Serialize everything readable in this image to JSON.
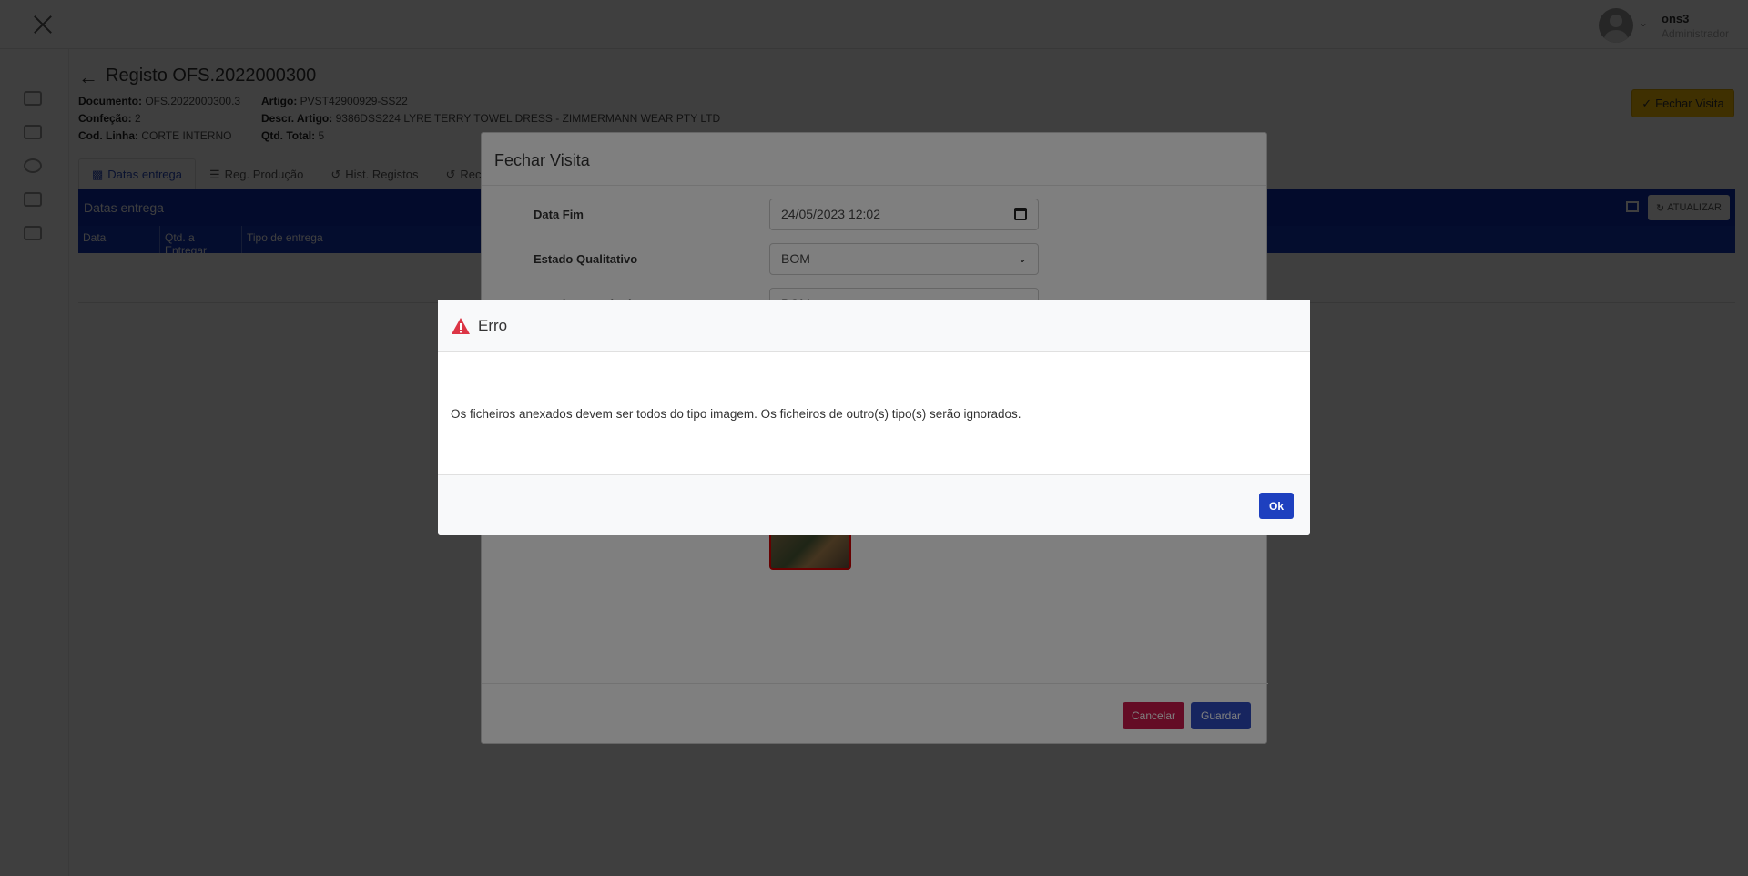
{
  "header": {
    "user_name": "ons3",
    "user_role": "Administrador"
  },
  "page": {
    "title": "Registo OFS.2022000300",
    "fechar_visita_label": "Fechar Visita",
    "info": {
      "documento_label": "Documento:",
      "documento": "OFS.2022000300.3",
      "confecao_label": "Confeção:",
      "confecao": "2",
      "cod_linha_label": "Cod. Linha:",
      "cod_linha": "CORTE INTERNO",
      "artigo_label": "Artigo:",
      "artigo": "PVST42900929-SS22",
      "descr_artigo_label": "Descr. Artigo:",
      "descr_artigo": "9386DSS224 LYRE TERRY TOWEL DRESS - ZIMMERMANN WEAR PTY LTD",
      "qtd_total_label": "Qtd. Total:",
      "qtd_total": "5"
    },
    "tabs": [
      "Datas entrega",
      "Reg. Produção",
      "Hist. Registos",
      "Rec. M"
    ],
    "panel_title": "Datas entrega",
    "atualizar_label": "ATUALIZAR",
    "grid_columns": [
      "Data",
      "Qtd. a Entregar",
      "Tipo de entrega"
    ]
  },
  "modal_fechar": {
    "title": "Fechar Visita",
    "data_fim_label": "Data Fim",
    "data_fim_value": "24/05/2023 12:02",
    "estado_qualitativo_label": "Estado Qualitativo",
    "estado_qualitativo_value": "BOM",
    "estado_quantitativo_label": "Estado Quantitativo",
    "estado_quantitativo_value": "BOM",
    "cancel_label": "Cancelar",
    "save_label": "Guardar"
  },
  "modal_erro": {
    "title": "Erro",
    "message": "Os ficheiros anexados devem ser todos do tipo imagem. Os ficheiros de outro(s) tipo(s) serão ignorados.",
    "ok_label": "Ok",
    "icon": "warning-triangle-icon",
    "icon_color": "#dc3545"
  }
}
